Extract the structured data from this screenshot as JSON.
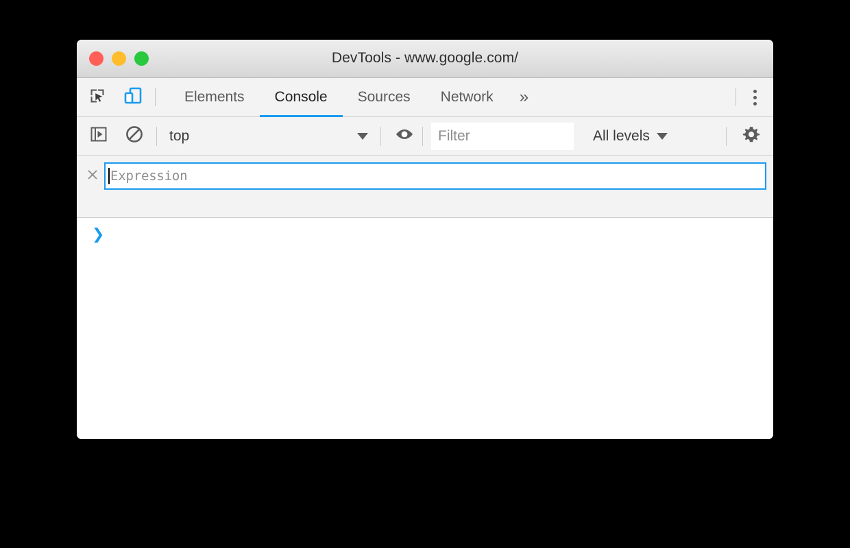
{
  "window": {
    "title": "DevTools - www.google.com/",
    "traffic_lights": [
      {
        "name": "close",
        "color": "#ff5f56"
      },
      {
        "name": "minimize",
        "color": "#ffbd2e"
      },
      {
        "name": "zoom",
        "color": "#28c93f"
      }
    ]
  },
  "tabbar": {
    "inspect_icon": "inspect-element-icon",
    "device_icon": "device-toolbar-icon",
    "tabs": [
      {
        "label": "Elements",
        "active": false
      },
      {
        "label": "Console",
        "active": true
      },
      {
        "label": "Sources",
        "active": false
      },
      {
        "label": "Network",
        "active": false
      }
    ],
    "overflow_label": "»",
    "more_options_icon": "vertical-dots-icon"
  },
  "console_toolbar": {
    "sidebar_toggle_icon": "console-sidebar-icon",
    "clear_console_icon": "clear-console-icon",
    "context": {
      "value": "top",
      "caret": "▼"
    },
    "live_expression_icon": "eye-icon",
    "filter": {
      "value": "",
      "placeholder": "Filter"
    },
    "levels": {
      "value": "All levels",
      "caret": "▼"
    },
    "settings_icon": "gear-icon"
  },
  "live_expression": {
    "remove_icon": "close-icon",
    "value": "",
    "placeholder": "Expression"
  },
  "console_output": {
    "prompt_chevron": "❯",
    "input_value": ""
  },
  "colors": {
    "accent": "#1a9bf0",
    "toolbar_bg": "#f3f3f3",
    "titlebar_bg": "#e4e4e4",
    "border": "#cdcdcd",
    "text": "#3a3a3a",
    "placeholder": "#8d8d8d"
  }
}
